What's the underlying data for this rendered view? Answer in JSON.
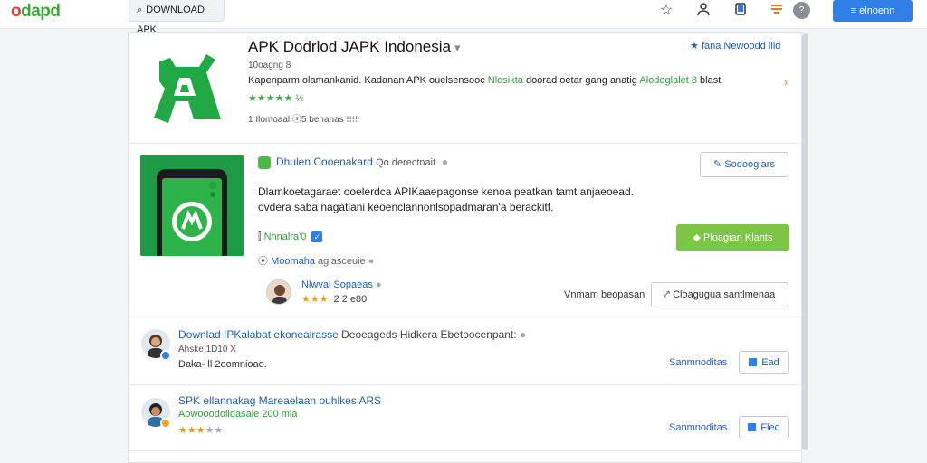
{
  "topbar": {
    "logo": "odapd",
    "search_icon": "search-icon",
    "search_text": "DOWNLOAD APK",
    "icons": [
      "star-icon",
      "user-icon",
      "tablet-icon",
      "flag-icon"
    ],
    "avatar_initial": "?",
    "button_label": "≡ elnoenn",
    "button_color": "#2f7fe6"
  },
  "app": {
    "title": "APK Dodrlod JAPK Indonesia",
    "caret": "▾",
    "subtitle": "10oagng 8",
    "description_pre": "Kapenparm olamankanid. Kadanan APK ouelsensooc ",
    "description_green1": "Nlosikta",
    "description_mid": " doorad oetar gang anatig ",
    "description_green2": "Alodoglalet 8",
    "description_post": " blast",
    "rating_text": "★★★★★ ½",
    "meta_text": "1 Ilomoaal  ⓢ5 benanas  ⁝⁝⁝⁝",
    "follow_star": "★",
    "follow_label": "fana Newoodd lild"
  },
  "card": {
    "app_name": "Dhulen Cooenakard",
    "publisher": "Qo derectnait",
    "info_dot": "●",
    "edit_button": "Sodooglars",
    "body": "Dlamkoetagaraet ooelerdca APIKaaepagonse kenoa peatkan tamt anjaeoead. ovdera saba nagatlani keoenclannonlsopadmaran'a berackitt.",
    "install_button": "Ploagian Klants",
    "install_color": "#7cc545",
    "stat1": "Nhnalra'0",
    "stat2_a": "Moomaha",
    "stat2_b": " aglasceuie",
    "reviewer_name": "Nlwval Sopaeas",
    "reviewer_stars": "★★★",
    "reviewer_count": "2 2 e80",
    "review_label": "Vnmam beopasan",
    "share_button": "Cloagugua santlmenaa"
  },
  "uploads": [
    {
      "title": "Downlad IPKalabat ekonealrasse",
      "title_muted": "  Deoeageds Hidkera Ebetoocenpant:",
      "sub": "Ahske 1D10 X",
      "sub2": "Daka-  ll 2oomnioao.",
      "link": "Sanmnoditas",
      "button": "Ead"
    },
    {
      "title": "SPK ellannakag Mareaelaan ouhlkes ARS",
      "green": "Aowooodolidasale 200 mla",
      "stars": "★★★",
      "stars_gray": "★★",
      "link": "Sanmnoditas",
      "button": "Fled"
    }
  ]
}
